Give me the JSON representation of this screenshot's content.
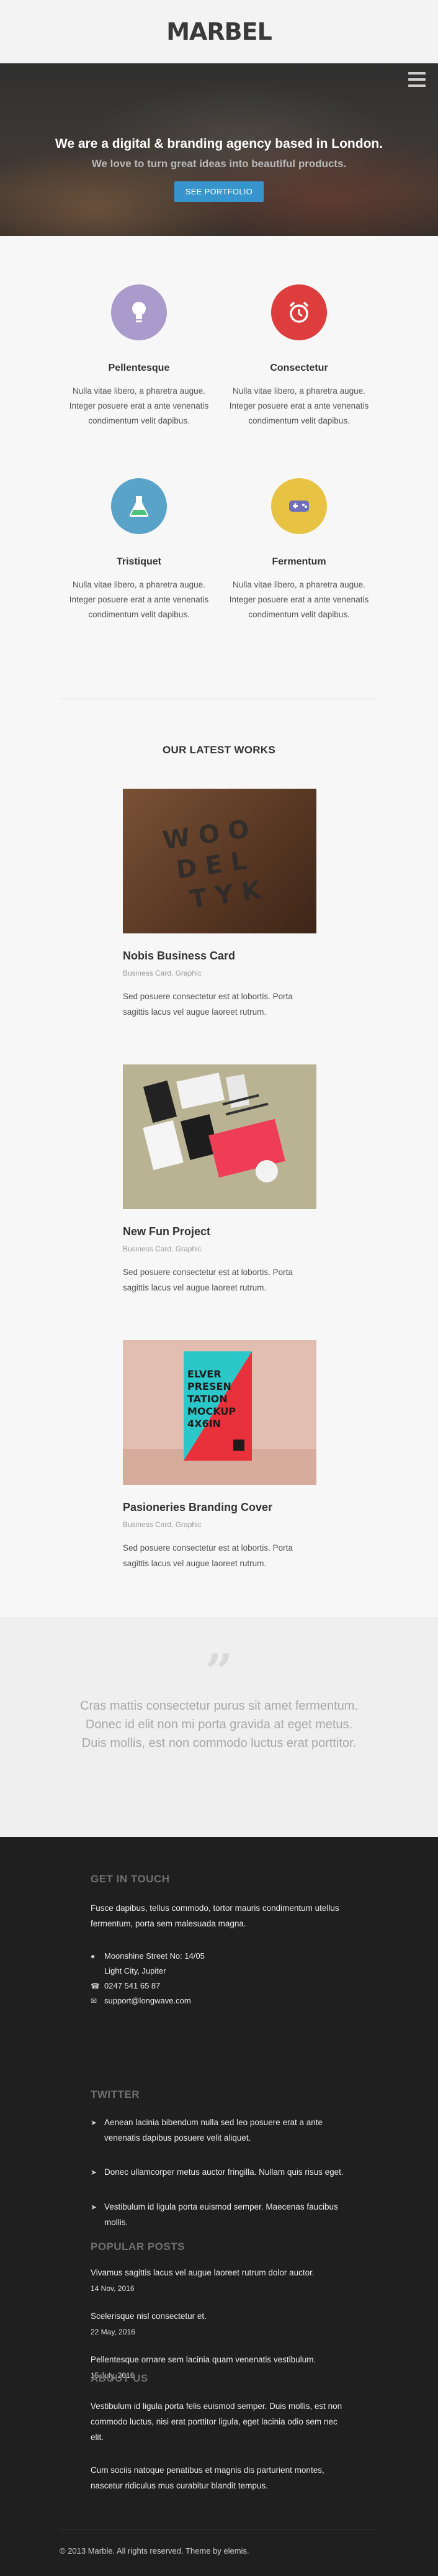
{
  "header": {
    "logo": "MARBEL"
  },
  "hero": {
    "title": "We are a digital & branding agency based in London.",
    "subtitle": "We love to turn great ideas into beautiful products.",
    "button": "SEE PORTFOLIO",
    "menu_icon": "hamburger-menu-icon"
  },
  "services": [
    {
      "icon": "lightbulb-icon",
      "color": "#a99bcb",
      "title": "Pellentesque",
      "text": "Nulla vitae libero, a pharetra augue. Integer posuere erat a ante venenatis condimentum velit dapibus."
    },
    {
      "icon": "alarm-clock-icon",
      "color": "#dd3d3c",
      "title": "Consectetur",
      "text": "Nulla vitae libero, a pharetra augue. Integer posuere erat a ante venenatis condimentum velit dapibus."
    },
    {
      "icon": "flask-icon",
      "color": "#58a3c7",
      "title": "Tristiquet",
      "text": "Nulla vitae libero, a pharetra augue. Integer posuere erat a ante venenatis condimentum velit dapibus."
    },
    {
      "icon": "gamepad-icon",
      "color": "#e8c242",
      "title": "Fermentum",
      "text": "Nulla vitae libero, a pharetra augue. Integer posuere erat a ante venenatis condimentum velit dapibus."
    }
  ],
  "works": {
    "title": "OUR LATEST WORKS",
    "items": [
      {
        "name": "Nobis Business Card",
        "meta": "Business Card, Graphic",
        "desc": "Sed posuere consectetur est at lobortis. Porta sagittis lacus vel augue laoreet rutrum."
      },
      {
        "name": "New Fun Project",
        "meta": "Business Card, Graphic",
        "desc": "Sed posuere consectetur est at lobortis. Porta sagittis lacus vel augue laoreet rutrum."
      },
      {
        "name": "Pasioneries Branding Cover",
        "meta": "Business Card, Graphic",
        "desc": "Sed posuere consectetur est at lobortis. Porta sagittis lacus vel augue laoreet rutrum."
      }
    ]
  },
  "quote": {
    "mark": "”",
    "text": "Cras mattis consectetur purus sit amet fermentum. Donec id elit non mi porta gravida at eget metus. Duis mollis, est non commodo luctus erat porttitor."
  },
  "footer": {
    "touch_heading": "GET IN TOUCH",
    "touch_text": "Fusce dapibus, tellus commodo, tortor mauris condimentum utellus fermentum, porta sem malesuada magna.",
    "address_1": "Moonshine Street No: 14/05",
    "address_2": "Light City, Jupiter",
    "phone": "0247 541 65 87",
    "email": "support@longwave.com",
    "twitter_heading": "TWITTER",
    "tweets": [
      "Aenean lacinia bibendum nulla sed leo posuere erat a ante venenatis dapibus posuere velit aliquet.",
      "Donec ullamcorper metus auctor fringilla. Nullam quis risus eget.",
      "Vestibulum id ligula porta euismod semper. Maecenas faucibus mollis."
    ],
    "posts_heading": "POPULAR POSTS",
    "posts": [
      {
        "title": "Vivamus sagittis lacus vel augue laoreet rutrum dolor auctor.",
        "date": "14 Nov, 2016"
      },
      {
        "title": "Scelerisque nisl consectetur et.",
        "date": "22 May, 2016"
      },
      {
        "title": "Pellentesque ornare sem lacinia quam venenatis vestibulum.",
        "date": "15 July, 2016"
      }
    ],
    "about_heading": "ABOUT US",
    "about_p1": "Vestibulum id ligula porta felis euismod semper. Duis mollis, est non commodo luctus, nisi erat porttitor ligula, eget lacinia odio sem nec elit.",
    "about_p2": "Cum sociis natoque penatibus et magnis dis parturient montes, nascetur ridiculus mus curabitur blandit tempus.",
    "copyright": "© 2013 Marble. All rights reserved. Theme by elemis."
  }
}
